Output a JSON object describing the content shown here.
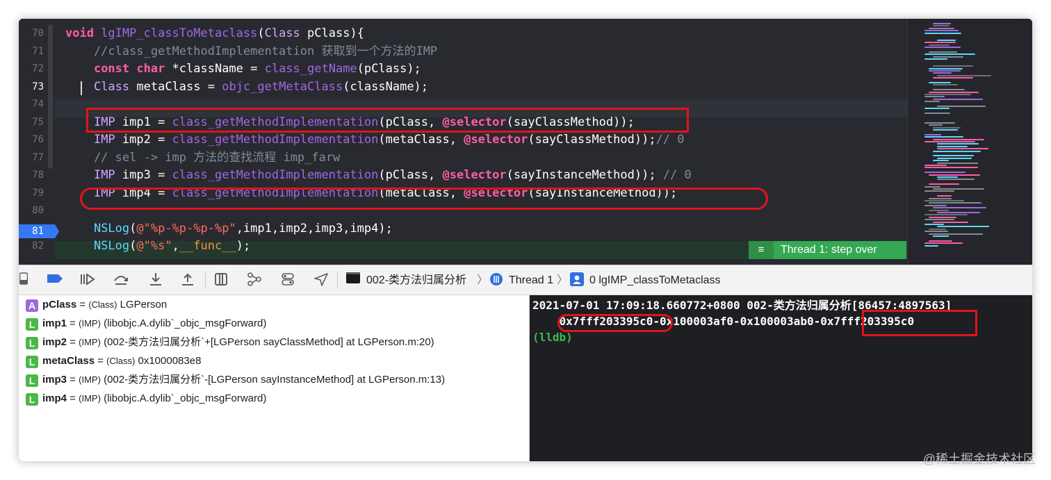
{
  "editor": {
    "line_numbers": [
      "70",
      "71",
      "72",
      "73",
      "74",
      "75",
      "76",
      "77",
      "78",
      "79",
      "80",
      "81",
      "82"
    ],
    "lines": [
      [
        [
          "kw",
          "void "
        ],
        [
          "fn",
          "lgIMP_classToMetaclass"
        ],
        [
          "p",
          "("
        ],
        [
          "ty",
          "Class"
        ],
        [
          "p",
          " pClass){"
        ]
      ],
      [
        [
          "cm",
          "    //class_getMethodImplementation 获取到一个方法的IMP"
        ]
      ],
      [
        [
          "p",
          "    "
        ],
        [
          "kw",
          "const char"
        ],
        [
          "p",
          " *className = "
        ],
        [
          "fn",
          "class_getName"
        ],
        [
          "p",
          "(pClass);"
        ]
      ],
      [
        [
          "p",
          "    "
        ],
        [
          "ty",
          "Class"
        ],
        [
          "p",
          " metaClass = "
        ],
        [
          "fn",
          "objc_getMetaClass"
        ],
        [
          "p",
          "(className);"
        ]
      ],
      [
        [
          "p",
          ""
        ]
      ],
      [
        [
          "p",
          "    "
        ],
        [
          "ty",
          "IMP"
        ],
        [
          "p",
          " imp1 = "
        ],
        [
          "fn",
          "class_getMethodImplementation"
        ],
        [
          "p",
          "(pClass, "
        ],
        [
          "kw",
          "@selector"
        ],
        [
          "p",
          "(sayClassMethod));"
        ]
      ],
      [
        [
          "p",
          "    "
        ],
        [
          "ty",
          "IMP"
        ],
        [
          "p",
          " imp2 = "
        ],
        [
          "fn",
          "class_getMethodImplementation"
        ],
        [
          "p",
          "(metaClass, "
        ],
        [
          "kw",
          "@selector"
        ],
        [
          "p",
          "(sayClassMethod));"
        ],
        [
          "cm",
          "// 0"
        ]
      ],
      [
        [
          "cm",
          "    // sel -> imp 方法的查找流程 imp_farw"
        ]
      ],
      [
        [
          "p",
          "    "
        ],
        [
          "ty",
          "IMP"
        ],
        [
          "p",
          " imp3 = "
        ],
        [
          "fn",
          "class_getMethodImplementation"
        ],
        [
          "p",
          "(pClass, "
        ],
        [
          "kw",
          "@selector"
        ],
        [
          "p",
          "(sayInstanceMethod)); "
        ],
        [
          "cm",
          "// 0"
        ]
      ],
      [
        [
          "p",
          "    "
        ],
        [
          "ty",
          "IMP"
        ],
        [
          "p",
          " imp4 = "
        ],
        [
          "fn",
          "class_getMethodImplementation"
        ],
        [
          "p",
          "(metaClass, "
        ],
        [
          "kw",
          "@selector"
        ],
        [
          "p",
          "(sayInstanceMethod));"
        ]
      ],
      [
        [
          "p",
          ""
        ]
      ],
      [
        [
          "p",
          "    "
        ],
        [
          "cls",
          "NSLog"
        ],
        [
          "p",
          "("
        ],
        [
          "str",
          "@\"%p-%p-%p-%p\""
        ],
        [
          "p",
          ",imp1,imp2,imp3,imp4);"
        ]
      ],
      [
        [
          "p",
          "    "
        ],
        [
          "cls",
          "NSLog"
        ],
        [
          "p",
          "("
        ],
        [
          "str",
          "@\"%s\""
        ],
        [
          "p",
          ","
        ],
        [
          "mac",
          "__func__"
        ],
        [
          "p",
          ");"
        ]
      ]
    ],
    "thread_badge": "Thread 1: step over"
  },
  "toolbar": {
    "target": "002-类方法归属分析",
    "thread": "Thread 1",
    "frame": "0 lgIMP_classToMetaclass"
  },
  "variables": [
    {
      "badge": "A",
      "name": "pClass",
      "eq": " = ",
      "type": "(Class)",
      "value": " LGPerson"
    },
    {
      "badge": "L",
      "name": "imp1",
      "eq": " = ",
      "type": "(IMP)",
      "value": " (libobjc.A.dylib`_objc_msgForward)"
    },
    {
      "badge": "L",
      "name": "imp2",
      "eq": " = ",
      "type": "(IMP)",
      "value": " (002-类方法归属分析`+[LGPerson sayClassMethod] at LGPerson.m:20)"
    },
    {
      "badge": "L",
      "name": "metaClass",
      "eq": " = ",
      "type": "(Class)",
      "value": " 0x1000083e8"
    },
    {
      "badge": "L",
      "name": "imp3",
      "eq": " = ",
      "type": "(IMP)",
      "value": " (002-类方法归属分析`-[LGPerson sayInstanceMethod] at LGPerson.m:13)"
    },
    {
      "badge": "L",
      "name": "imp4",
      "eq": " = ",
      "type": "(IMP)",
      "value": " (libobjc.A.dylib`_objc_msgForward)"
    }
  ],
  "console": {
    "line1": "2021-07-01 17:09:18.660772+0800 002-类方法归属分析[86457:4897563]",
    "line2": "    0x7fff203395c0-0x100003af0-0x100003ab0-0x7fff203395c0",
    "prompt": "(lldb)"
  },
  "watermark": "@稀土掘金技术社区",
  "colors": {
    "editor_bg": "#292a30",
    "keyword": "#fc5fa3",
    "function": "#a167e6",
    "highlight_box": "#e2131a",
    "thread_badge": "#34a853",
    "lldb_prompt": "#3fb950"
  }
}
